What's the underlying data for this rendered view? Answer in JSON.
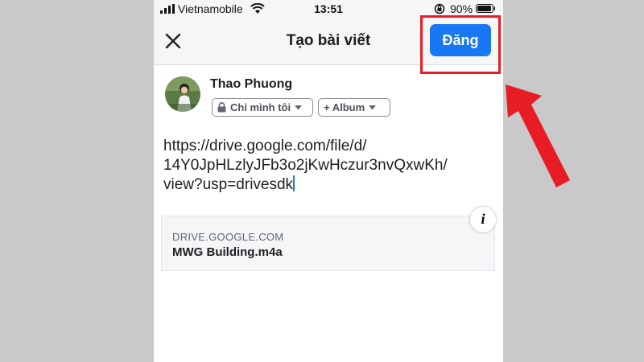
{
  "status_bar": {
    "carrier": "Vietnamobile",
    "time": "13:51",
    "battery_percent": "90%"
  },
  "header": {
    "title": "Tạo bài viết",
    "post_button_label": "Đăng"
  },
  "author": {
    "name": "Thao Phuong",
    "privacy_label": "Chỉ mình tôi",
    "album_label": "+ Album"
  },
  "post": {
    "text_lines": [
      "https://drive.google.com/file/d/",
      "14Y0JpHLzlyJFb3o2jKwHczur3nvQxwKh/",
      "view?usp=drivesdk"
    ]
  },
  "link_preview": {
    "domain": "DRIVE.GOOGLE.COM",
    "title": "MWG Building.m4a",
    "info_label": "i"
  },
  "colors": {
    "accent": "#1877f2",
    "annotation": "#e81c24",
    "background": "#c9c9c9"
  }
}
